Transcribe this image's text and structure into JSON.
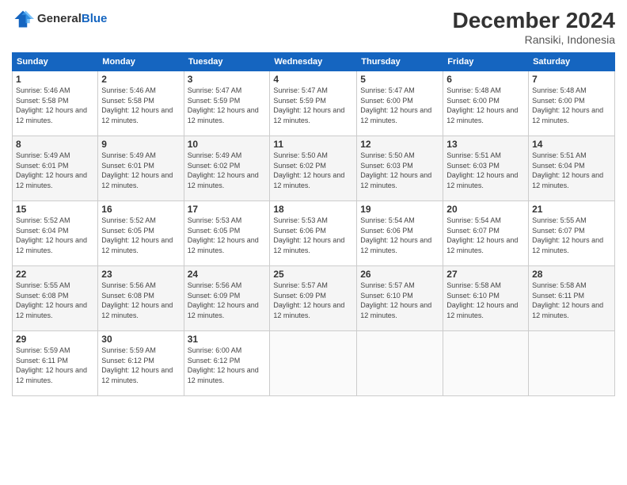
{
  "logo": {
    "general": "General",
    "blue": "Blue"
  },
  "header": {
    "month": "December 2024",
    "location": "Ransiki, Indonesia"
  },
  "weekdays": [
    "Sunday",
    "Monday",
    "Tuesday",
    "Wednesday",
    "Thursday",
    "Friday",
    "Saturday"
  ],
  "weeks": [
    [
      {
        "day": "1",
        "sunrise": "5:46 AM",
        "sunset": "5:58 PM",
        "daylight": "12 hours and 12 minutes."
      },
      {
        "day": "2",
        "sunrise": "5:46 AM",
        "sunset": "5:58 PM",
        "daylight": "12 hours and 12 minutes."
      },
      {
        "day": "3",
        "sunrise": "5:47 AM",
        "sunset": "5:59 PM",
        "daylight": "12 hours and 12 minutes."
      },
      {
        "day": "4",
        "sunrise": "5:47 AM",
        "sunset": "5:59 PM",
        "daylight": "12 hours and 12 minutes."
      },
      {
        "day": "5",
        "sunrise": "5:47 AM",
        "sunset": "6:00 PM",
        "daylight": "12 hours and 12 minutes."
      },
      {
        "day": "6",
        "sunrise": "5:48 AM",
        "sunset": "6:00 PM",
        "daylight": "12 hours and 12 minutes."
      },
      {
        "day": "7",
        "sunrise": "5:48 AM",
        "sunset": "6:00 PM",
        "daylight": "12 hours and 12 minutes."
      }
    ],
    [
      {
        "day": "8",
        "sunrise": "5:49 AM",
        "sunset": "6:01 PM",
        "daylight": "12 hours and 12 minutes."
      },
      {
        "day": "9",
        "sunrise": "5:49 AM",
        "sunset": "6:01 PM",
        "daylight": "12 hours and 12 minutes."
      },
      {
        "day": "10",
        "sunrise": "5:49 AM",
        "sunset": "6:02 PM",
        "daylight": "12 hours and 12 minutes."
      },
      {
        "day": "11",
        "sunrise": "5:50 AM",
        "sunset": "6:02 PM",
        "daylight": "12 hours and 12 minutes."
      },
      {
        "day": "12",
        "sunrise": "5:50 AM",
        "sunset": "6:03 PM",
        "daylight": "12 hours and 12 minutes."
      },
      {
        "day": "13",
        "sunrise": "5:51 AM",
        "sunset": "6:03 PM",
        "daylight": "12 hours and 12 minutes."
      },
      {
        "day": "14",
        "sunrise": "5:51 AM",
        "sunset": "6:04 PM",
        "daylight": "12 hours and 12 minutes."
      }
    ],
    [
      {
        "day": "15",
        "sunrise": "5:52 AM",
        "sunset": "6:04 PM",
        "daylight": "12 hours and 12 minutes."
      },
      {
        "day": "16",
        "sunrise": "5:52 AM",
        "sunset": "6:05 PM",
        "daylight": "12 hours and 12 minutes."
      },
      {
        "day": "17",
        "sunrise": "5:53 AM",
        "sunset": "6:05 PM",
        "daylight": "12 hours and 12 minutes."
      },
      {
        "day": "18",
        "sunrise": "5:53 AM",
        "sunset": "6:06 PM",
        "daylight": "12 hours and 12 minutes."
      },
      {
        "day": "19",
        "sunrise": "5:54 AM",
        "sunset": "6:06 PM",
        "daylight": "12 hours and 12 minutes."
      },
      {
        "day": "20",
        "sunrise": "5:54 AM",
        "sunset": "6:07 PM",
        "daylight": "12 hours and 12 minutes."
      },
      {
        "day": "21",
        "sunrise": "5:55 AM",
        "sunset": "6:07 PM",
        "daylight": "12 hours and 12 minutes."
      }
    ],
    [
      {
        "day": "22",
        "sunrise": "5:55 AM",
        "sunset": "6:08 PM",
        "daylight": "12 hours and 12 minutes."
      },
      {
        "day": "23",
        "sunrise": "5:56 AM",
        "sunset": "6:08 PM",
        "daylight": "12 hours and 12 minutes."
      },
      {
        "day": "24",
        "sunrise": "5:56 AM",
        "sunset": "6:09 PM",
        "daylight": "12 hours and 12 minutes."
      },
      {
        "day": "25",
        "sunrise": "5:57 AM",
        "sunset": "6:09 PM",
        "daylight": "12 hours and 12 minutes."
      },
      {
        "day": "26",
        "sunrise": "5:57 AM",
        "sunset": "6:10 PM",
        "daylight": "12 hours and 12 minutes."
      },
      {
        "day": "27",
        "sunrise": "5:58 AM",
        "sunset": "6:10 PM",
        "daylight": "12 hours and 12 minutes."
      },
      {
        "day": "28",
        "sunrise": "5:58 AM",
        "sunset": "6:11 PM",
        "daylight": "12 hours and 12 minutes."
      }
    ],
    [
      {
        "day": "29",
        "sunrise": "5:59 AM",
        "sunset": "6:11 PM",
        "daylight": "12 hours and 12 minutes."
      },
      {
        "day": "30",
        "sunrise": "5:59 AM",
        "sunset": "6:12 PM",
        "daylight": "12 hours and 12 minutes."
      },
      {
        "day": "31",
        "sunrise": "6:00 AM",
        "sunset": "6:12 PM",
        "daylight": "12 hours and 12 minutes."
      },
      null,
      null,
      null,
      null
    ]
  ],
  "labels": {
    "sunrise": "Sunrise:",
    "sunset": "Sunset:",
    "daylight": "Daylight:"
  }
}
